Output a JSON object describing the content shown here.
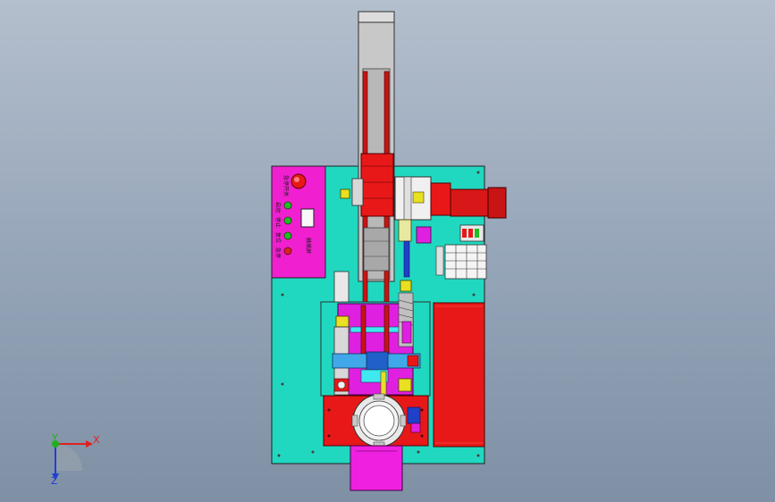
{
  "viewport": {
    "background_top": "#b4bfcd",
    "background_bottom": "#7f90a5"
  },
  "triad": {
    "x_label": "X",
    "y_label": "Y",
    "z_label": "Z",
    "x_color": "#e02020",
    "y_color": "#20b020",
    "z_color": "#2040d0"
  },
  "control_panel": {
    "color": "#f020d0",
    "button_labels": [
      "启动",
      "停止",
      "复位",
      "急停"
    ],
    "top_label": "急停开关",
    "side_label": "触摸屏",
    "lamp_colors": [
      "#20c020",
      "#20c020",
      "#20c020",
      "#e02020"
    ]
  },
  "colors": {
    "base_plate": "#20d8c0",
    "magenta": "#e020e0",
    "red": "#e81818",
    "dark_red": "#b01010",
    "grey": "#c8c8c8",
    "yellow": "#e8e020",
    "cyan": "#40e8f0",
    "blue": "#2040c8",
    "steel": "#dcdcdc"
  }
}
